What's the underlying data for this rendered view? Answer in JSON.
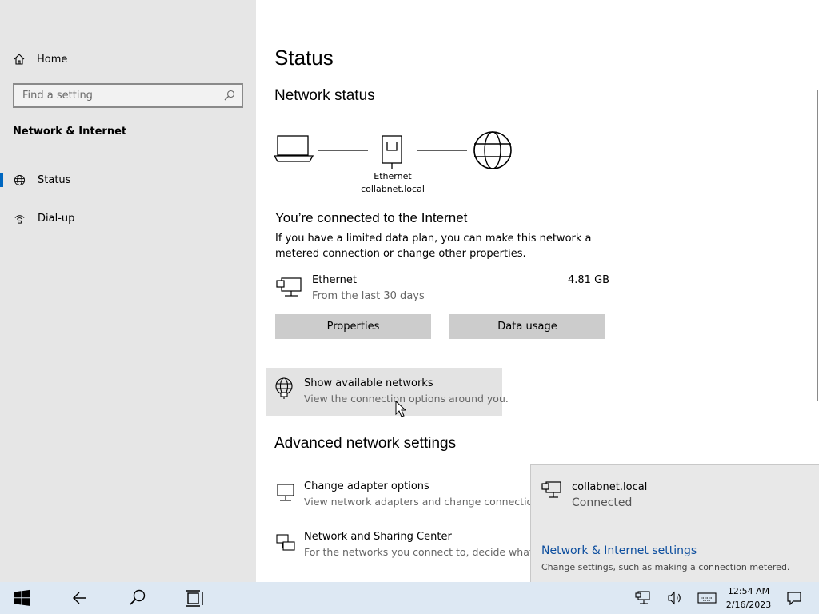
{
  "sidebar": {
    "home_label": "Home",
    "search_placeholder": "Find a setting",
    "section_title": "Network & Internet",
    "items": [
      {
        "label": "Status",
        "icon": "globe-icon"
      },
      {
        "label": "Dial-up",
        "icon": "dialup-icon"
      }
    ]
  },
  "main": {
    "title": "Status",
    "network_status_heading": "Network status",
    "diagram": {
      "adapter_label": "Ethernet",
      "network_label": "collabnet.local"
    },
    "connected_heading": "You’re connected to the Internet",
    "connected_desc": "If you have a limited data plan, you can make this network a metered connection or change other properties.",
    "ethernet": {
      "name": "Ethernet",
      "subtitle": "From the last 30 days",
      "usage": "4.81 GB"
    },
    "buttons": {
      "properties": "Properties",
      "data_usage": "Data usage"
    },
    "show_networks": {
      "title": "Show available networks",
      "subtitle": "View the connection options around you."
    },
    "advanced_heading": "Advanced network settings",
    "advanced_items": [
      {
        "title": "Change adapter options",
        "subtitle": "View network adapters and change connection se"
      },
      {
        "title": "Network and Sharing Center",
        "subtitle": "For the networks you connect to, decide what you"
      }
    ]
  },
  "flyout": {
    "network_name": "collabnet.local",
    "network_status": "Connected",
    "settings_link": "Network & Internet settings",
    "settings_sub": "Change settings, such as making a connection metered."
  },
  "taskbar": {
    "time": "12:54 AM",
    "date": "2/16/2023"
  },
  "colors": {
    "accent": "#0067c0",
    "link": "#0b4d9e",
    "sidebar_bg": "#e6e6e6",
    "taskbar_bg": "#dde8f3"
  }
}
